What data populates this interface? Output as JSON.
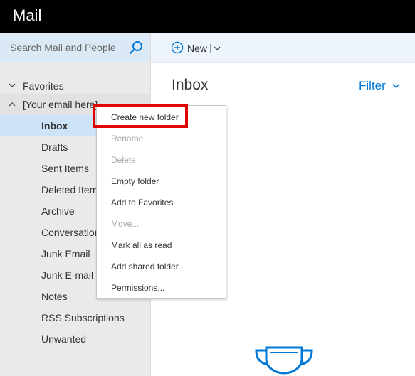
{
  "app": {
    "title": "Mail"
  },
  "search": {
    "placeholder": "Search Mail and People"
  },
  "toolbar": {
    "new_label": "New"
  },
  "tree": {
    "favorites_label": "Favorites",
    "account_label": "[Your email here]"
  },
  "folders": [
    {
      "label": "Inbox",
      "selected": true
    },
    {
      "label": "Drafts"
    },
    {
      "label": "Sent Items"
    },
    {
      "label": "Deleted Items"
    },
    {
      "label": "Archive"
    },
    {
      "label": "Conversation History"
    },
    {
      "label": "Junk Email"
    },
    {
      "label": "Junk E-mail"
    },
    {
      "label": "Notes"
    },
    {
      "label": "RSS Subscriptions"
    },
    {
      "label": "Unwanted"
    }
  ],
  "main": {
    "title": "Inbox",
    "filter_label": "Filter"
  },
  "context_menu": {
    "items": [
      {
        "label": "Create new folder",
        "enabled": true,
        "highlighted": true
      },
      {
        "label": "Rename",
        "enabled": false
      },
      {
        "label": "Delete",
        "enabled": false
      },
      {
        "label": "Empty folder",
        "enabled": true
      },
      {
        "label": "Add to Favorites",
        "enabled": true
      },
      {
        "label": "Move...",
        "enabled": false
      },
      {
        "label": "Mark all as read",
        "enabled": true
      },
      {
        "label": "Add shared folder...",
        "enabled": true
      },
      {
        "label": "Permissions...",
        "enabled": true
      }
    ]
  },
  "colors": {
    "accent": "#0078d7",
    "highlight_box": "#e00000",
    "selected_folder_bg": "#cde3f7"
  }
}
